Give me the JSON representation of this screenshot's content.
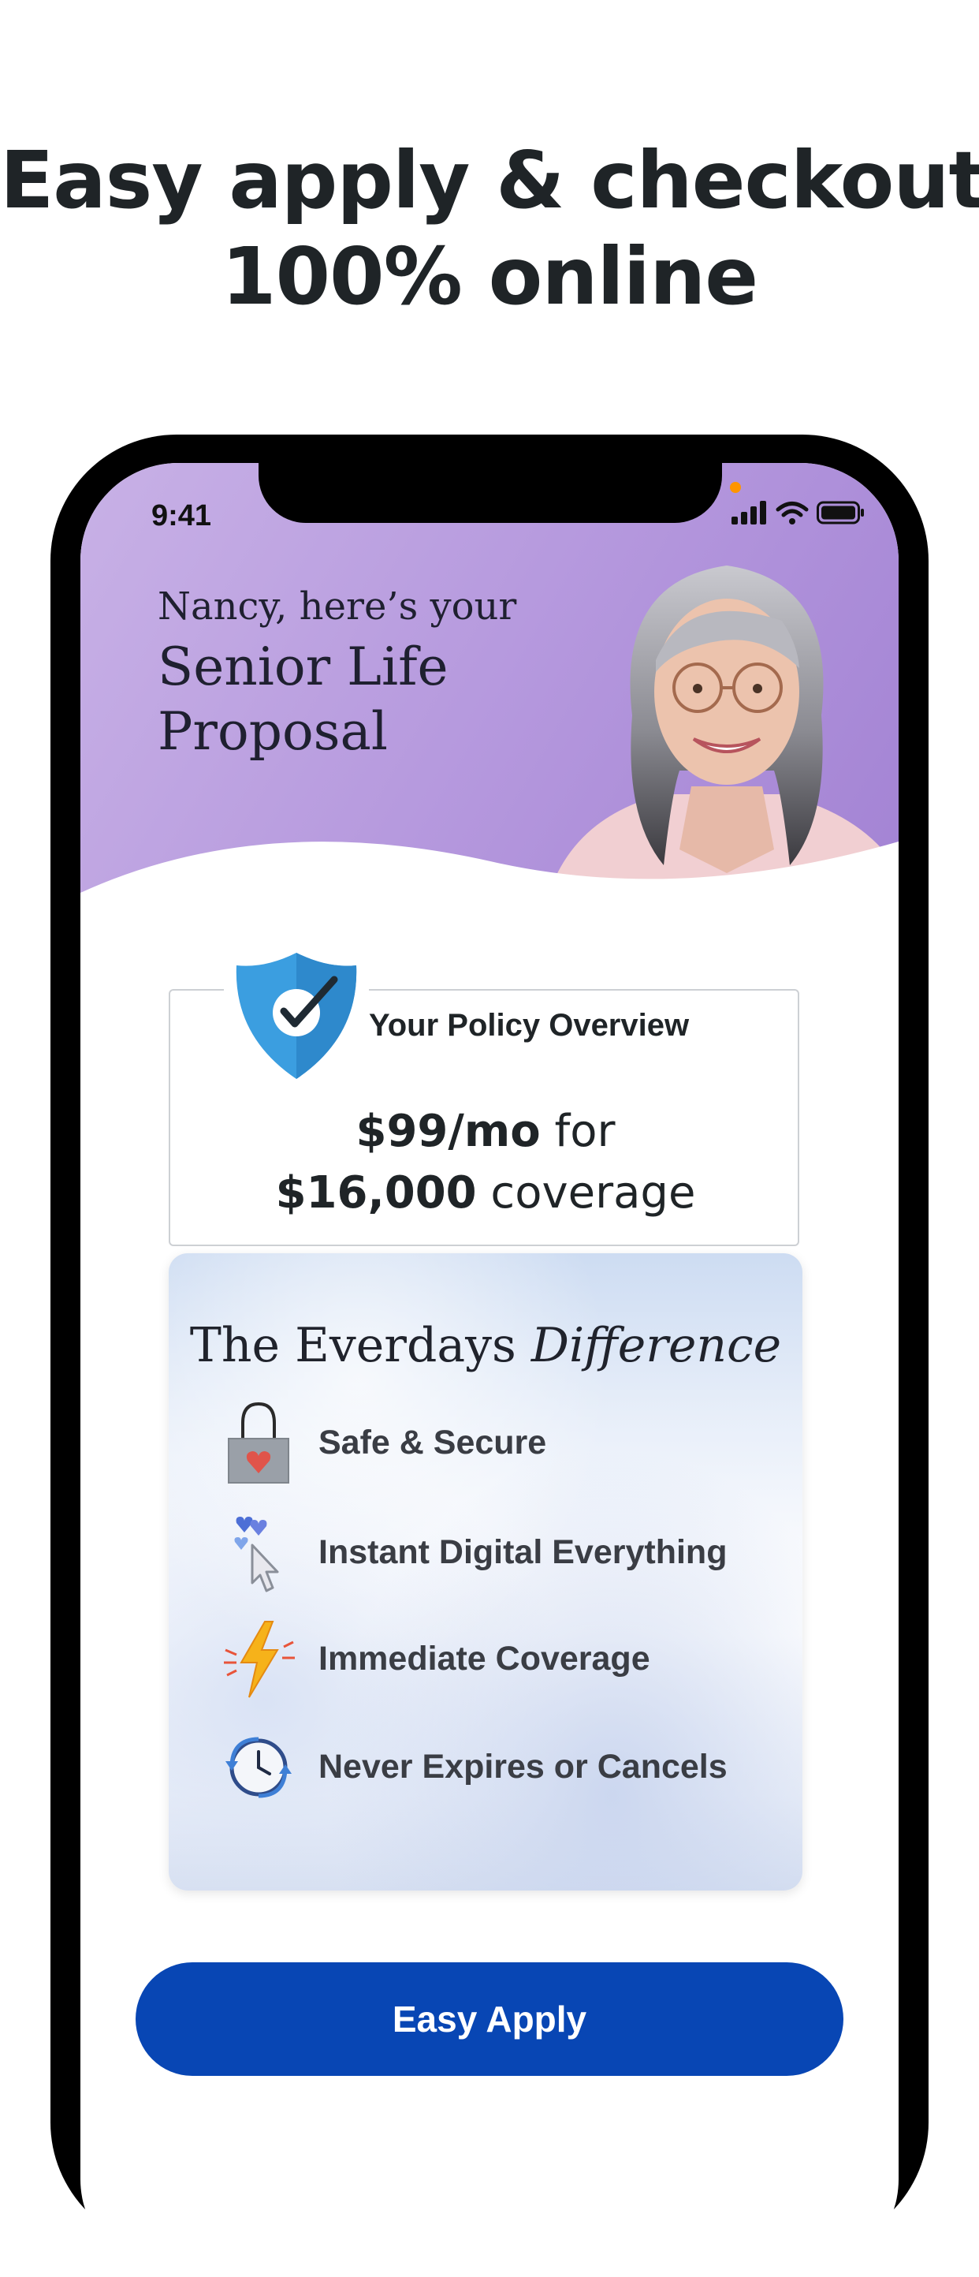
{
  "headline": {
    "line1": "Easy apply & checkout",
    "line2": "100% online"
  },
  "status_bar": {
    "time": "9:41",
    "icons": [
      "signal-icon",
      "wifi-icon",
      "battery-icon"
    ]
  },
  "hero": {
    "greeting": "Nancy, here’s your",
    "title_line1": "Senior Life",
    "title_line2": "Proposal",
    "image": "senior-woman-portrait",
    "background_color": "#b497dd"
  },
  "policy_overview": {
    "title": "Your Policy Overview",
    "premium": "$99/mo",
    "premium_suffix": " for",
    "coverage": "$16,000",
    "coverage_suffix": " coverage",
    "icon": "shield-check-icon"
  },
  "difference": {
    "title_regular": "The Everdays ",
    "title_italic": "Difference",
    "items": [
      {
        "label": "Safe & Secure",
        "icon": "padlock-heart-icon"
      },
      {
        "label": "Instant Digital Everything",
        "icon": "hearts-cursor-icon"
      },
      {
        "label": "Immediate Coverage",
        "icon": "lightning-bolt-icon"
      },
      {
        "label": "Never Expires or Cancels",
        "icon": "clock-renew-icon"
      }
    ]
  },
  "cta": {
    "label": "Easy Apply",
    "color": "#0846b4"
  }
}
